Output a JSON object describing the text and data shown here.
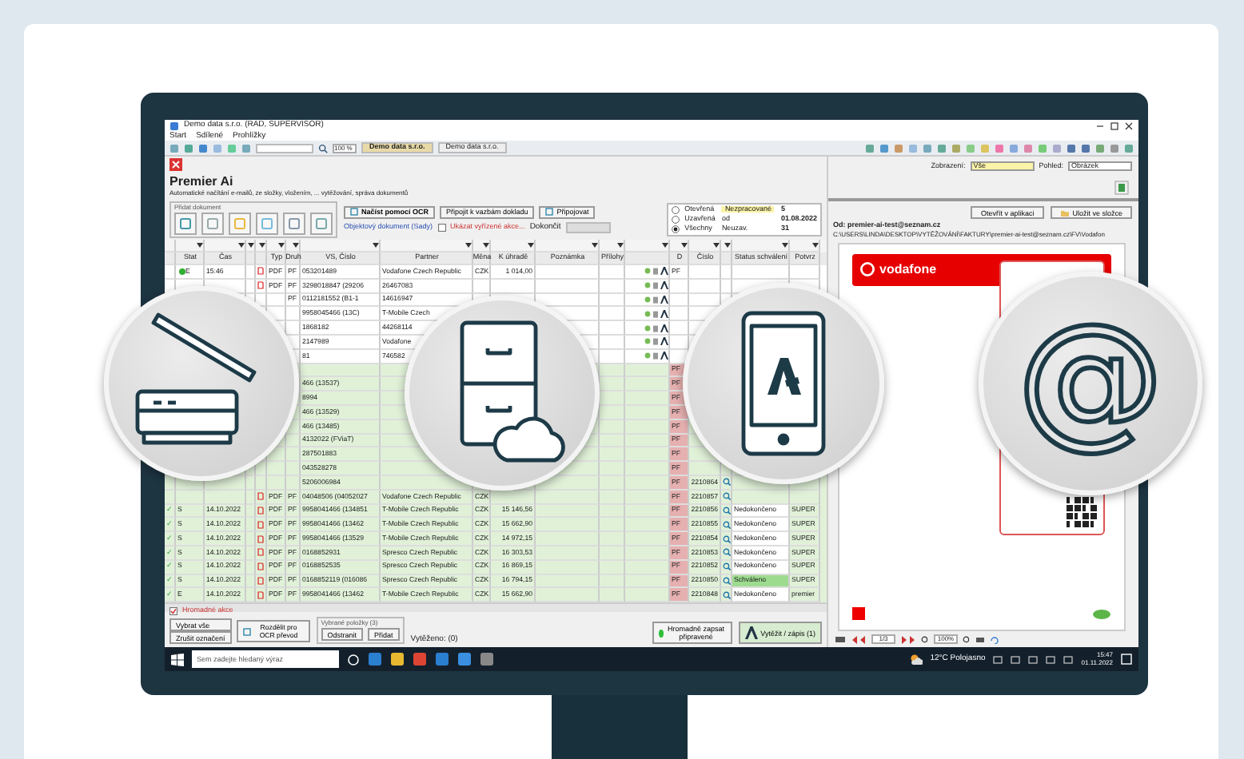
{
  "window": {
    "title": "Demo data s.r.o. (RAD, SUPERVISOR)",
    "menu": [
      "Start",
      "Sdílené",
      "Prohlížky"
    ],
    "zoom": "100 %",
    "tabs": [
      {
        "label": "Demo data s.r.o.",
        "selected": true
      },
      {
        "label": "Demo data s.r.o.",
        "selected": false
      }
    ]
  },
  "header": {
    "title": "Premier Ai",
    "subtitle": "Automatické načítání e-mailů, ze složky, vložením, ... vytěžování, správa dokumentů"
  },
  "add_document": {
    "label": "Přidat dokument",
    "buttons": [
      "Načíst pomocí OCR",
      "Připojit k vazbám dokladu",
      "Připojovat"
    ],
    "link": "Objektový dokument (Sady)",
    "checkbox": {
      "label": "Ukázat vyřízené akce...",
      "checked": false
    },
    "field_label": "Dokončit"
  },
  "filter": [
    {
      "label": "Otevřená",
      "selected": false,
      "tag": "Nezpracované",
      "value": "5"
    },
    {
      "label": "Uzavřená",
      "selected": false,
      "tag": "od",
      "value": "01.08.2022"
    },
    {
      "label": "Všechny",
      "selected": true,
      "tag": "Neuzav.",
      "value": "31"
    }
  ],
  "table": {
    "columns": {
      "stat": "Stat",
      "date": "Čas",
      "doc": "Typ",
      "type": "Druh",
      "vs": "VS, Číslo",
      "partner": "Partner",
      "currency": "Měna",
      "amount": "K úhradě",
      "note": "Poznámka",
      "attach": "Přílohy",
      "dtype": "D",
      "number": "Číslo",
      "approval": "Status schválení",
      "user": "Potvrz"
    },
    "rows": [
      {
        "color": "#2fae2f",
        "stat": "E",
        "date": "15:46",
        "doc": "PDF",
        "type": "PF",
        "vs": "053201489",
        "partner": "Vodafone Czech Republic",
        "currency": "CZK",
        "amount": "1 014,00",
        "actions": true,
        "dtype": "PF",
        "processed": false
      },
      {
        "doc": "PDF",
        "type": "PF",
        "vs": "3298018847 (29206",
        "partner": "26467083",
        "actions": true,
        "processed": false
      },
      {
        "type": "PF",
        "vs": "0112181552 (B1-1",
        "partner": "14616947",
        "actions": true,
        "processed": false
      },
      {
        "vs": "9958045466 (13C)",
        "partner": "T-Mobile Czech",
        "actions": true,
        "processed": false
      },
      {
        "vs": "1868182",
        "partner": "44268114",
        "actions": true,
        "processed": false
      },
      {
        "vs": "2147989",
        "partner": "Vodafone",
        "actions": true,
        "processed": false
      },
      {
        "vs": "81",
        "partner": "746582",
        "actions": true,
        "processed": false
      },
      {
        "dtype": "PF",
        "processed": true
      },
      {
        "vs": "466 (13537)",
        "dtype": "PF",
        "processed": true
      },
      {
        "vs": "8994",
        "dtype": "PF",
        "processed": true
      },
      {
        "vs": "466 (13529)",
        "dtype": "PF",
        "processed": true
      },
      {
        "vs": "466 (13485)",
        "dtype": "PF",
        "processed": true
      },
      {
        "vs": "4132022 (FViaT)",
        "dtype": "PF",
        "processed": true
      },
      {
        "vs": "287501883",
        "dtype": "PF",
        "processed": true
      },
      {
        "vs": "043528278",
        "dtype": "PF",
        "processed": true
      },
      {
        "vs": "5206006984",
        "dtype": "PF",
        "number": "2210864",
        "lookup": true,
        "processed": true
      },
      {
        "doc": "PDF",
        "type": "PF",
        "vs": "04048506 (04052027",
        "partner": "Vodafone Czech Republic",
        "currency": "CZK",
        "dtype": "PF",
        "number": "2210857",
        "lookup": true,
        "processed": true
      },
      {
        "check": "✓",
        "stat": "S",
        "date": "14.10.2022",
        "doc": "PDF",
        "type": "PF",
        "vs": "9958041466 (134851",
        "partner": "T-Mobile Czech Republic",
        "currency": "CZK",
        "amount": "15 146,56",
        "dtype": "PF",
        "number": "2210856",
        "lookup": true,
        "approval": "Nedokončeno",
        "approved": false,
        "user": "SUPER",
        "processed": true
      },
      {
        "check": "✓",
        "stat": "S",
        "date": "14.10.2022",
        "doc": "PDF",
        "type": "PF",
        "vs": "9958041466 (13462",
        "partner": "T-Mobile Czech Republic",
        "currency": "CZK",
        "amount": "15 662,90",
        "dtype": "PF",
        "number": "2210855",
        "lookup": true,
        "approval": "Nedokončeno",
        "approved": false,
        "user": "SUPER",
        "processed": true
      },
      {
        "check": "✓",
        "stat": "S",
        "date": "14.10.2022",
        "doc": "PDF",
        "type": "PF",
        "vs": "9958041466 (13529",
        "partner": "T-Mobile Czech Republic",
        "currency": "CZK",
        "amount": "14 972,15",
        "dtype": "PF",
        "number": "2210854",
        "lookup": true,
        "approval": "Nedokončeno",
        "approved": false,
        "user": "SUPER",
        "processed": true
      },
      {
        "check": "✓",
        "stat": "S",
        "date": "14.10.2022",
        "doc": "PDF",
        "type": "PF",
        "vs": "0168852931",
        "partner": "Spresco Czech Republic",
        "currency": "CZK",
        "amount": "16 303,53",
        "dtype": "PF",
        "number": "2210853",
        "lookup": true,
        "approval": "Nedokončeno",
        "approved": false,
        "user": "SUPER",
        "processed": true
      },
      {
        "check": "✓",
        "stat": "S",
        "date": "14.10.2022",
        "doc": "PDF",
        "type": "PF",
        "vs": "0168852535",
        "partner": "Spresco Czech Republic",
        "currency": "CZK",
        "amount": "16 869,15",
        "dtype": "PF",
        "number": "2210852",
        "lookup": true,
        "approval": "Nedokončeno",
        "approved": false,
        "user": "SUPER",
        "processed": true
      },
      {
        "check": "✓",
        "stat": "S",
        "date": "14.10.2022",
        "doc": "PDF",
        "type": "PF",
        "vs": "0168852119 (016086",
        "partner": "Spresco Czech Republic",
        "currency": "CZK",
        "amount": "16 794,15",
        "dtype": "PF",
        "number": "2210850",
        "lookup": true,
        "approval": "Schváleno",
        "approved": true,
        "user": "SUPER",
        "processed": true
      },
      {
        "check": "✓",
        "stat": "E",
        "date": "14.10.2022",
        "doc": "PDF",
        "type": "PF",
        "vs": "9958041466 (13462",
        "partner": "T-Mobile Czech Republic",
        "currency": "CZK",
        "amount": "15 662,90",
        "dtype": "PF",
        "number": "2210848",
        "lookup": true,
        "approval": "Nedokončeno",
        "approved": false,
        "user": "premier",
        "processed": true
      }
    ]
  },
  "bulk": {
    "checkbox": {
      "label": "Hromadné akce",
      "checked": true
    },
    "buttons": [
      "Vybrat vše",
      "Zrušit označení",
      "Rozdělit pro OCR převod"
    ],
    "group": "Vybrané položky (3)",
    "group_buttons": [
      "Odstranit",
      "Přidat"
    ],
    "count": "Vytěženo: (0)",
    "ready": "Hromadně zapsat připravené",
    "extract": "Vytěžit / zápis (1)"
  },
  "preview": {
    "view_label": "Zobrazení:",
    "view": "Vše",
    "look_label": "Pohled:",
    "look": "Obrázek",
    "buttons": [
      "Otevřít v aplikaci",
      "Uložit ve složce"
    ],
    "from": "Od: premier-ai-test@seznam.cz",
    "path": "C:\\USERS\\LINDA\\DESKTOP\\VYTĚŽOVÁNÍ\\FAKTURY\\premier-ai-test@seznam.cz\\FV\\Vodafon",
    "brand": "vodafone",
    "page": "1/3",
    "zoom": "100%"
  },
  "taskbar": {
    "search": {
      "placeholder": "Sem zadejte hledaný výraz"
    },
    "weather": "12°C Polojasno",
    "time": "15:47",
    "date": "01.11.2022"
  },
  "circles": [
    {
      "kind": "scanner"
    },
    {
      "kind": "cabinet"
    },
    {
      "kind": "phone"
    },
    {
      "kind": "email",
      "symbol": "@"
    }
  ]
}
